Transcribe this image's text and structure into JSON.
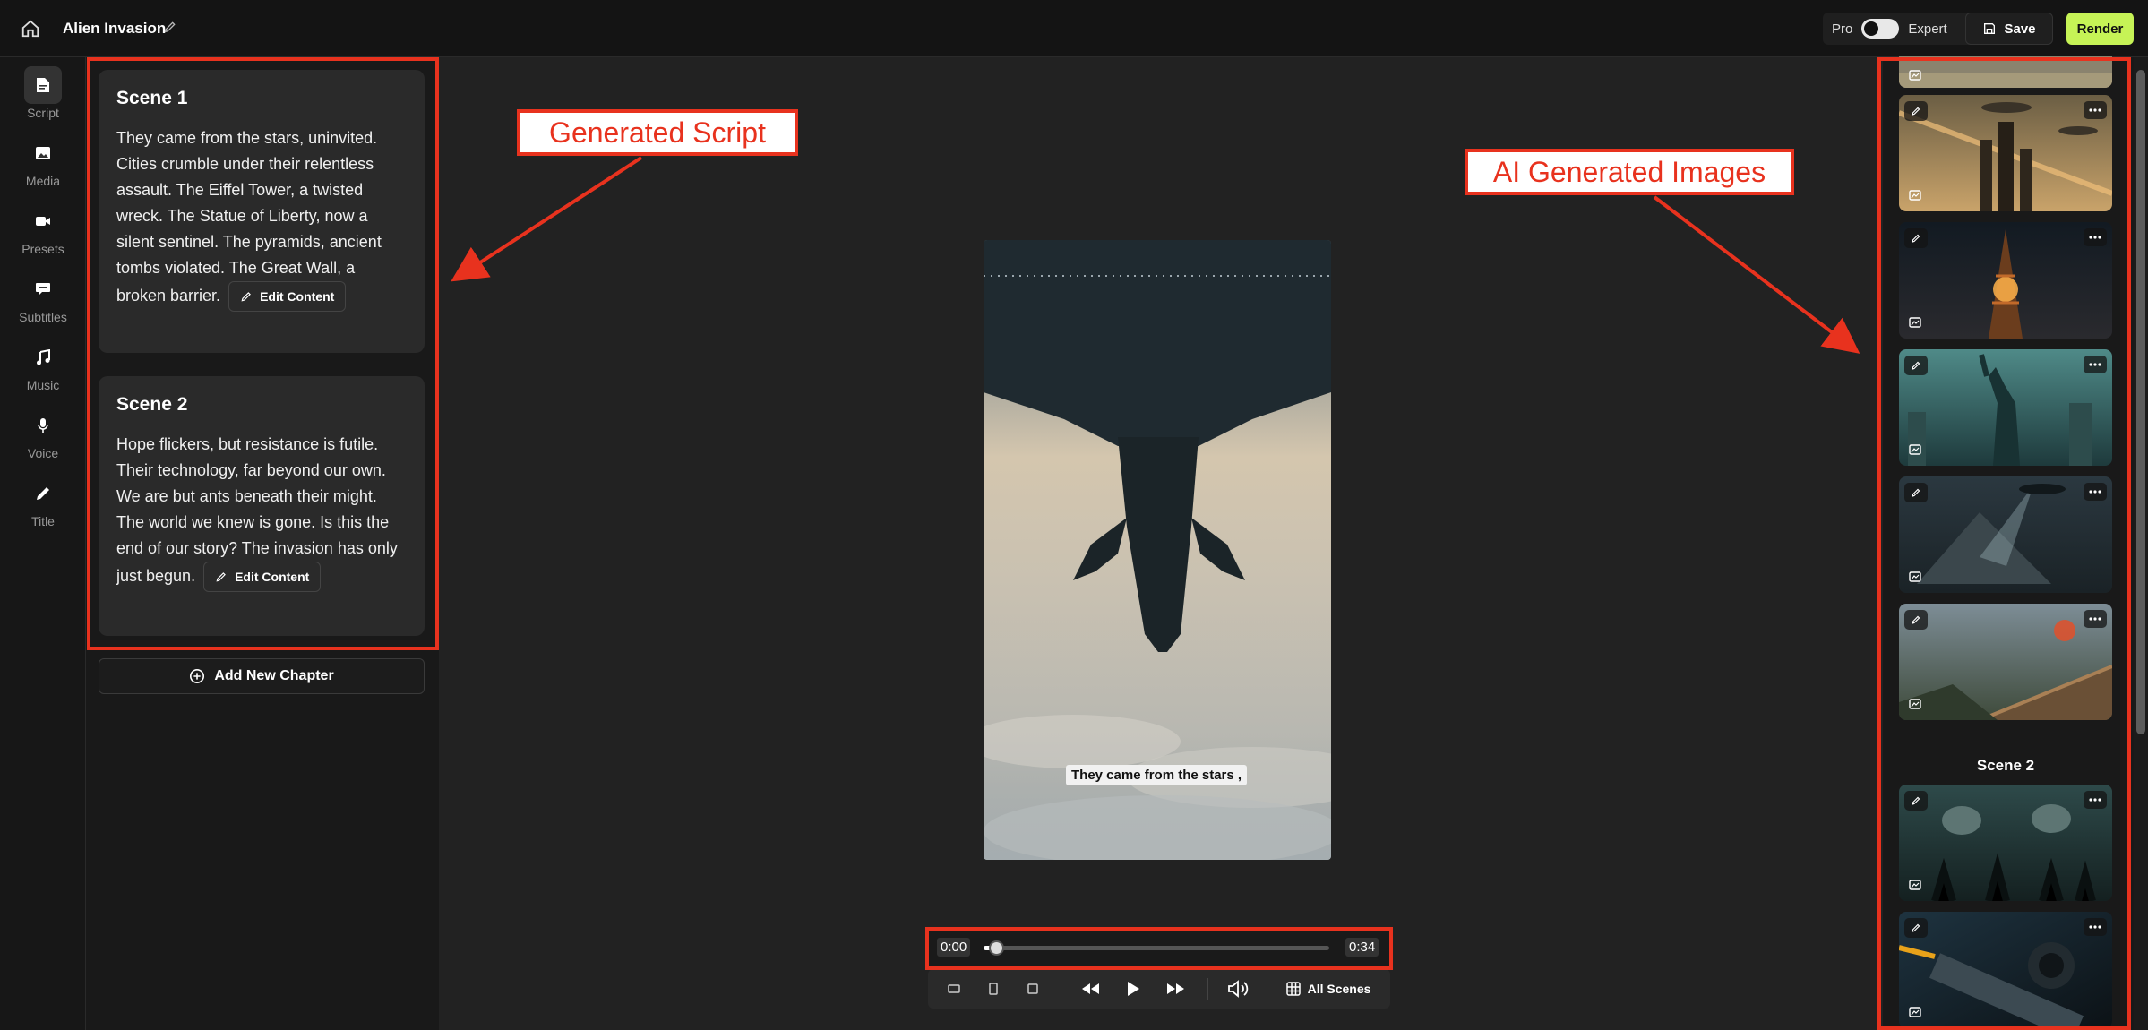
{
  "header": {
    "title": "Alien Invasion",
    "pro_label": "Pro",
    "expert_label": "Expert",
    "save_label": "Save",
    "render_label": "Render"
  },
  "nav": {
    "items": [
      {
        "label": "Script",
        "icon": "file-text-icon"
      },
      {
        "label": "Media",
        "icon": "image-icon"
      },
      {
        "label": "Presets",
        "icon": "video-camera-icon"
      },
      {
        "label": "Subtitles",
        "icon": "speech-bubble-icon"
      },
      {
        "label": "Music",
        "icon": "music-note-icon"
      },
      {
        "label": "Voice",
        "icon": "microphone-icon"
      },
      {
        "label": "Title",
        "icon": "pen-icon"
      }
    ]
  },
  "script": {
    "scenes": [
      {
        "title": "Scene 1",
        "text": "They came from the stars, uninvited. Cities crumble under their relentless assault. The Eiffel Tower, a twisted wreck. The Statue of Liberty, now a silent sentinel. The pyramids, ancient tombs violated. The Great Wall, a broken barrier."
      },
      {
        "title": "Scene 2",
        "text": "Hope flickers, but resistance is futile. Their technology, far beyond our own. We are but ants beneath their might. The world we knew is gone. Is this the end of our story? The invasion has only just begun."
      }
    ],
    "edit_label": "Edit Content",
    "add_chapter_label": "Add New Chapter"
  },
  "annotations": {
    "script_label": "Generated Script",
    "images_label": "AI Generated Images"
  },
  "player": {
    "caption": "They came from the stars ,",
    "current_time": "0:00",
    "total_time": "0:34",
    "progress": 0.02,
    "all_scenes_label": "All Scenes"
  },
  "images_panel": {
    "scene2_label": "Scene 2"
  }
}
